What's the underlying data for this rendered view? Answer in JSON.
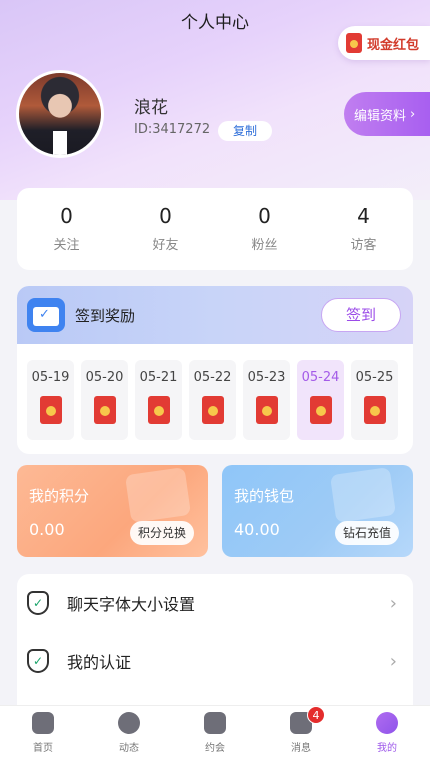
{
  "header": {
    "title": "个人中心",
    "cash_redpacket": "现金红包"
  },
  "profile": {
    "name": "浪花",
    "id_text": "ID:3417272",
    "copy_label": "复制",
    "edit_label": "编辑资料"
  },
  "stats": [
    {
      "value": "0",
      "label": "关注"
    },
    {
      "value": "0",
      "label": "好友"
    },
    {
      "value": "0",
      "label": "粉丝"
    },
    {
      "value": "4",
      "label": "访客"
    }
  ],
  "checkin": {
    "title": "签到奖励",
    "button": "签到",
    "days": [
      "05-19",
      "05-20",
      "05-21",
      "05-22",
      "05-23",
      "05-24",
      "05-25"
    ],
    "highlighted_day": "05-24"
  },
  "points": {
    "title": "我的积分",
    "value": "0.00",
    "button": "积分兑换"
  },
  "wallet": {
    "title": "我的钱包",
    "value": "40.00",
    "button": "钻石充值"
  },
  "menu": [
    {
      "label": "聊天字体大小设置",
      "icon": "shield-check-icon"
    },
    {
      "label": "我的认证",
      "icon": "shield-check-icon"
    }
  ],
  "tabbar": [
    {
      "label": "首页",
      "icon": "home-icon"
    },
    {
      "label": "动态",
      "icon": "leaf-icon"
    },
    {
      "label": "约会",
      "icon": "heart-icon"
    },
    {
      "label": "消息",
      "icon": "chat-icon",
      "badge": "4"
    },
    {
      "label": "我的",
      "icon": "profile-icon",
      "active": true
    }
  ],
  "colors": {
    "accent": "#9d58ea",
    "redpacket": "#e23b34",
    "points": "#fca77d",
    "wallet": "#8fc6f8"
  }
}
